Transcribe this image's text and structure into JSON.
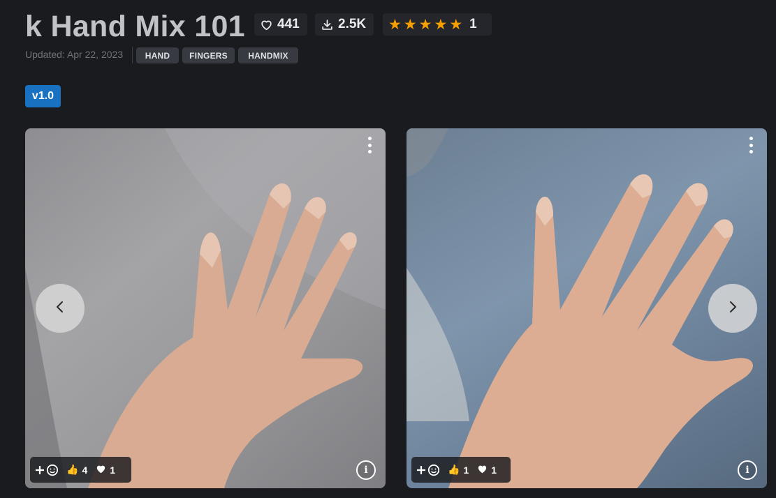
{
  "model": {
    "title": "k Hand Mix 101",
    "likes": "441",
    "downloads": "2.5K",
    "rating_count": "1",
    "stars": 5
  },
  "meta": {
    "updated": "Updated: Apr 22, 2023",
    "tags": [
      "HAND",
      "FINGERS",
      "HANDMIX"
    ]
  },
  "versions": [
    "v1.0"
  ],
  "gallery": [
    {
      "likes": "4",
      "hearts": "1"
    },
    {
      "likes": "1",
      "hearts": "1"
    }
  ],
  "colors": {
    "accent": "#1971c2",
    "star": "#f59f00",
    "background": "#1a1b1e"
  }
}
